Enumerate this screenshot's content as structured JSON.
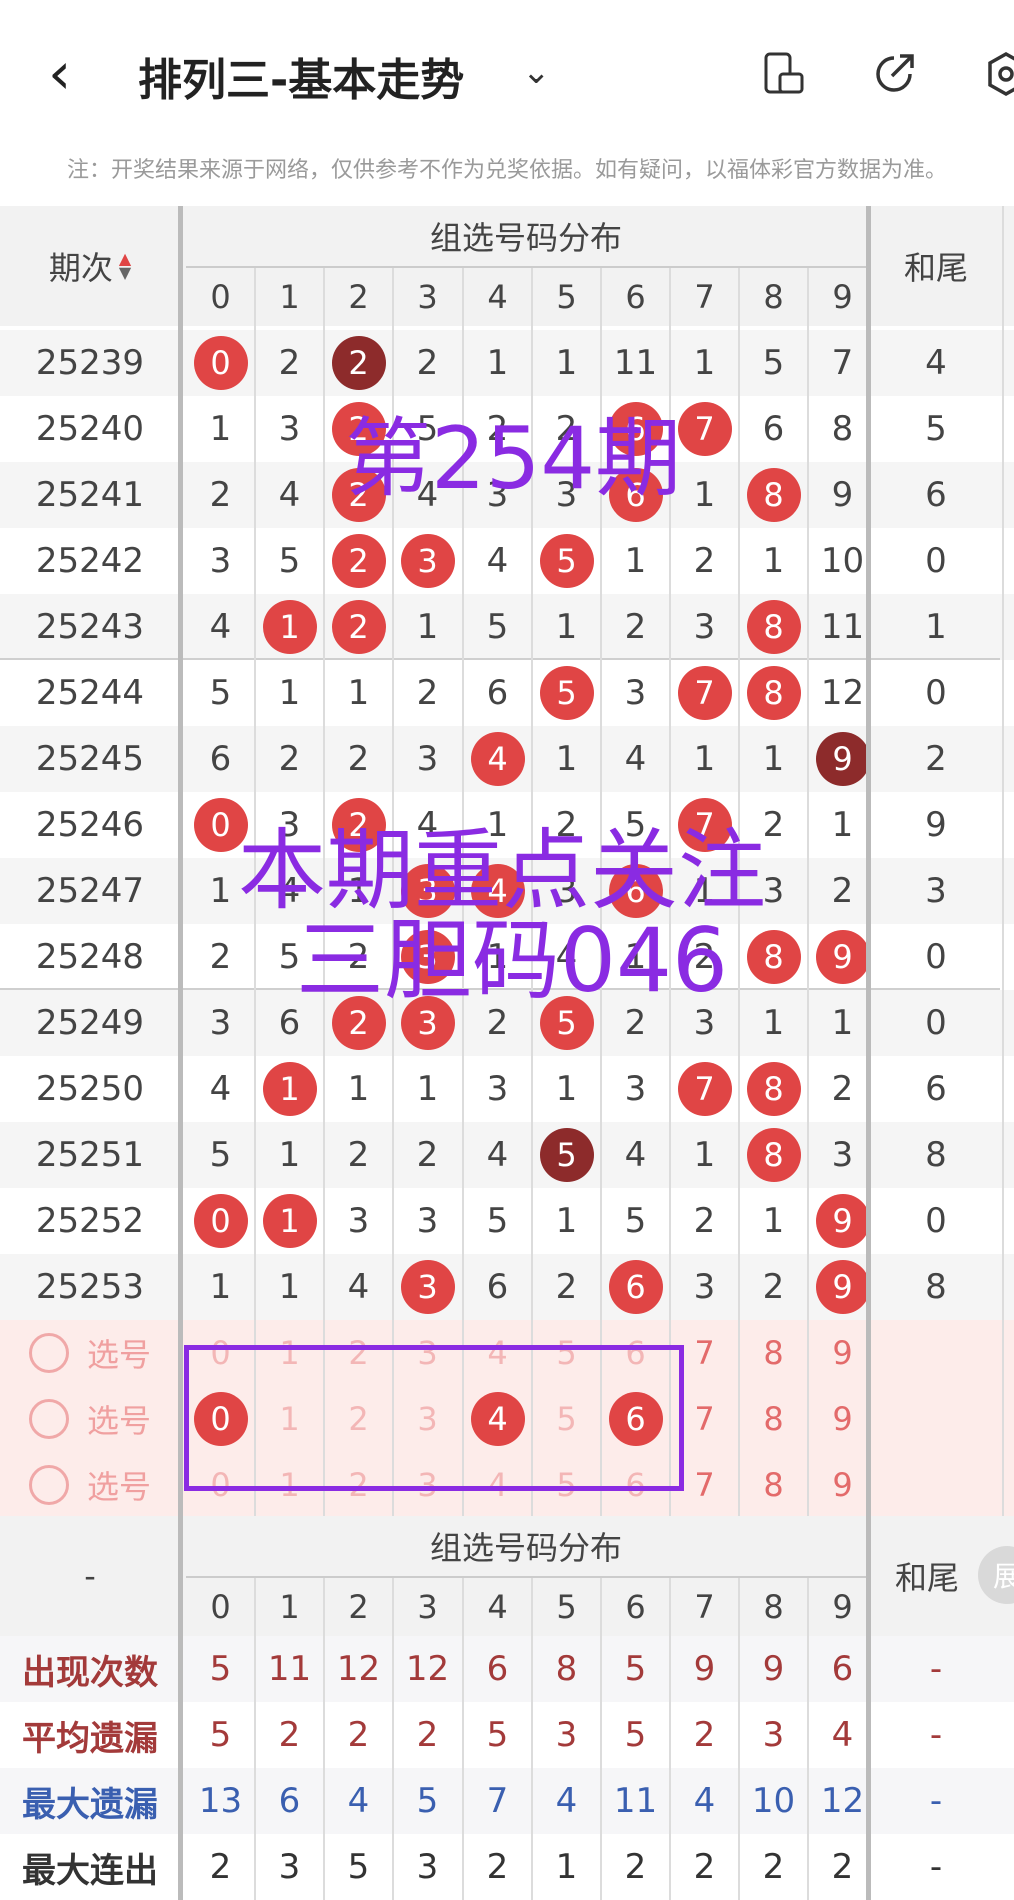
{
  "header": {
    "back_glyph": "‹",
    "title": "排列三-基本走势",
    "dropdown_icon": "chevron-down-icon",
    "icons": [
      "phone-layout-icon",
      "share-icon",
      "settings-icon"
    ]
  },
  "note": "注：开奖结果来源于网络，仅供参考不作为兑奖依据。如有疑问，以福体彩官方数据为准。",
  "table": {
    "col_issue": "期次",
    "col_group": "组选号码分布",
    "col_tail": "和尾",
    "digits": [
      "0",
      "1",
      "2",
      "3",
      "4",
      "5",
      "6",
      "7",
      "8",
      "9"
    ],
    "rows": [
      {
        "issue": "25239",
        "cells": [
          "0",
          "2",
          "2",
          "2",
          "1",
          "1",
          "11",
          "1",
          "5",
          "7"
        ],
        "ball": [
          1,
          0,
          2,
          0,
          0,
          0,
          0,
          0,
          0,
          0
        ],
        "tail": "4"
      },
      {
        "issue": "25240",
        "cells": [
          "1",
          "3",
          "2",
          "5",
          "2",
          "2",
          "6",
          "7",
          "6",
          "8"
        ],
        "ball": [
          0,
          0,
          1,
          0,
          0,
          0,
          1,
          1,
          0,
          0
        ],
        "tail": "5"
      },
      {
        "issue": "25241",
        "cells": [
          "2",
          "4",
          "2",
          "4",
          "3",
          "3",
          "6",
          "1",
          "8",
          "9"
        ],
        "ball": [
          0,
          0,
          1,
          0,
          0,
          0,
          1,
          0,
          1,
          0
        ],
        "tail": "6"
      },
      {
        "issue": "25242",
        "cells": [
          "3",
          "5",
          "2",
          "3",
          "4",
          "5",
          "1",
          "2",
          "1",
          "10"
        ],
        "ball": [
          0,
          0,
          1,
          1,
          0,
          1,
          0,
          0,
          0,
          0
        ],
        "tail": "0"
      },
      {
        "issue": "25243",
        "cells": [
          "4",
          "1",
          "2",
          "1",
          "5",
          "1",
          "2",
          "3",
          "8",
          "11"
        ],
        "ball": [
          0,
          1,
          1,
          0,
          0,
          0,
          0,
          0,
          1,
          0
        ],
        "tail": "1"
      },
      {
        "issue": "25244",
        "cells": [
          "5",
          "1",
          "1",
          "2",
          "6",
          "5",
          "3",
          "7",
          "8",
          "12"
        ],
        "ball": [
          0,
          0,
          0,
          0,
          0,
          1,
          0,
          1,
          1,
          0
        ],
        "tail": "0"
      },
      {
        "issue": "25245",
        "cells": [
          "6",
          "2",
          "2",
          "3",
          "4",
          "1",
          "4",
          "1",
          "1",
          "9"
        ],
        "ball": [
          0,
          0,
          0,
          0,
          1,
          0,
          0,
          0,
          0,
          2
        ],
        "tail": "2"
      },
      {
        "issue": "25246",
        "cells": [
          "0",
          "3",
          "2",
          "4",
          "1",
          "2",
          "5",
          "7",
          "2",
          "1"
        ],
        "ball": [
          1,
          0,
          1,
          0,
          0,
          0,
          0,
          1,
          0,
          0
        ],
        "tail": "9"
      },
      {
        "issue": "25247",
        "cells": [
          "1",
          "4",
          "1",
          "3",
          "4",
          "3",
          "6",
          "1",
          "3",
          "2"
        ],
        "ball": [
          0,
          0,
          0,
          1,
          1,
          0,
          1,
          0,
          0,
          0
        ],
        "tail": "3"
      },
      {
        "issue": "25248",
        "cells": [
          "2",
          "5",
          "2",
          "3",
          "1",
          "4",
          "1",
          "2",
          "8",
          "9"
        ],
        "ball": [
          0,
          0,
          0,
          1,
          0,
          0,
          0,
          0,
          1,
          1
        ],
        "tail": "0"
      },
      {
        "issue": "25249",
        "cells": [
          "3",
          "6",
          "2",
          "3",
          "2",
          "5",
          "2",
          "3",
          "1",
          "1"
        ],
        "ball": [
          0,
          0,
          1,
          1,
          0,
          1,
          0,
          0,
          0,
          0
        ],
        "tail": "0"
      },
      {
        "issue": "25250",
        "cells": [
          "4",
          "1",
          "1",
          "1",
          "3",
          "1",
          "3",
          "7",
          "8",
          "2"
        ],
        "ball": [
          0,
          1,
          0,
          0,
          0,
          0,
          0,
          1,
          1,
          0
        ],
        "tail": "6"
      },
      {
        "issue": "25251",
        "cells": [
          "5",
          "1",
          "2",
          "2",
          "4",
          "5",
          "4",
          "1",
          "8",
          "3"
        ],
        "ball": [
          0,
          0,
          0,
          0,
          0,
          2,
          0,
          0,
          1,
          0
        ],
        "tail": "8"
      },
      {
        "issue": "25252",
        "cells": [
          "0",
          "1",
          "3",
          "3",
          "5",
          "1",
          "5",
          "2",
          "1",
          "9"
        ],
        "ball": [
          1,
          1,
          0,
          0,
          0,
          0,
          0,
          0,
          0,
          1
        ],
        "tail": "0"
      },
      {
        "issue": "25253",
        "cells": [
          "1",
          "1",
          "4",
          "3",
          "6",
          "2",
          "6",
          "3",
          "2",
          "9"
        ],
        "ball": [
          0,
          0,
          0,
          1,
          0,
          0,
          1,
          0,
          0,
          1
        ],
        "tail": "8"
      }
    ],
    "pick_label": "选号",
    "pick_rows": [
      {
        "selected": []
      },
      {
        "selected": [
          "0",
          "4",
          "6"
        ]
      },
      {
        "selected": []
      }
    ]
  },
  "stats": {
    "corner": "-",
    "col_group": "组选号码分布",
    "col_tail": "和尾",
    "expand_label": "展",
    "rows": [
      {
        "label": "出现次数",
        "color": "#a33a3a",
        "values": [
          "5",
          "11",
          "12",
          "12",
          "6",
          "8",
          "5",
          "9",
          "9",
          "6"
        ],
        "tail": "-"
      },
      {
        "label": "平均遗漏",
        "color": "#a33a3a",
        "values": [
          "5",
          "2",
          "2",
          "2",
          "5",
          "3",
          "5",
          "2",
          "3",
          "4"
        ],
        "tail": "-"
      },
      {
        "label": "最大遗漏",
        "color": "#3a5fb0",
        "values": [
          "13",
          "6",
          "4",
          "5",
          "7",
          "4",
          "11",
          "4",
          "10",
          "12"
        ],
        "tail": "-"
      },
      {
        "label": "最大连出",
        "color": "#333333",
        "values": [
          "2",
          "3",
          "5",
          "3",
          "2",
          "1",
          "2",
          "2",
          "2",
          "2"
        ],
        "tail": "-"
      }
    ]
  },
  "overlays": {
    "issue_text": "第254期",
    "focus_line1": "本期重点关注",
    "focus_line2": "三胆码046"
  },
  "colors": {
    "ball_red": "#e04545",
    "ball_dark": "#8d2b2b",
    "overlay_purple": "#8a2be2",
    "pick_bg": "#fdecea"
  }
}
